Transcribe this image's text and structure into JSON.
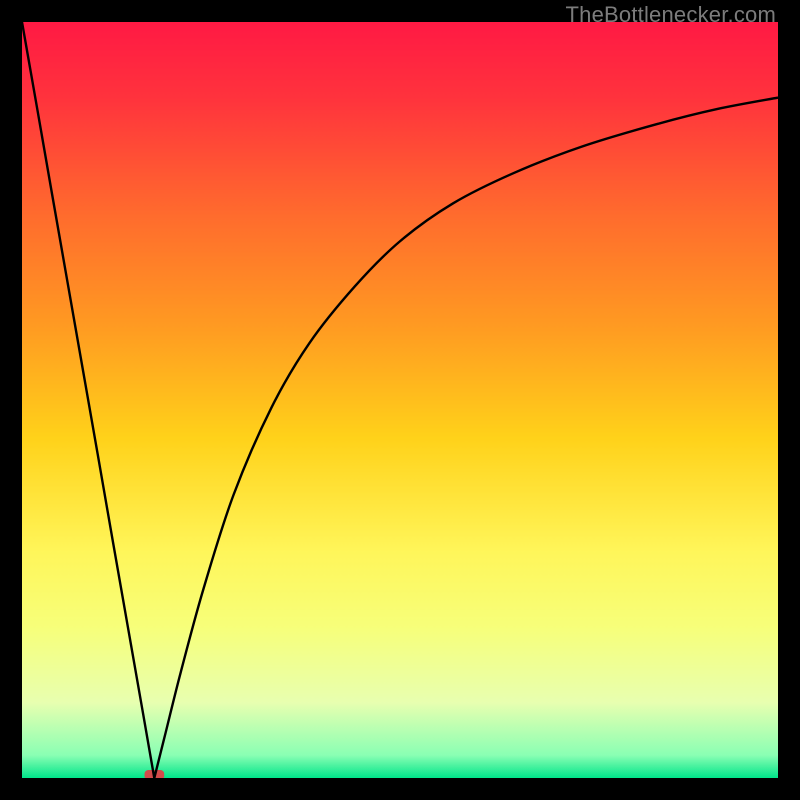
{
  "watermark_text": "TheBottlenecker.com",
  "marker_color": "#d24b4b",
  "curve_color": "#000000",
  "gradient_stops": [
    {
      "offset": 0.0,
      "color": "#ff1a44"
    },
    {
      "offset": 0.1,
      "color": "#ff333d"
    },
    {
      "offset": 0.25,
      "color": "#ff6a2e"
    },
    {
      "offset": 0.4,
      "color": "#ff9a22"
    },
    {
      "offset": 0.55,
      "color": "#ffd21a"
    },
    {
      "offset": 0.7,
      "color": "#fff65a"
    },
    {
      "offset": 0.8,
      "color": "#f7ff7a"
    },
    {
      "offset": 0.9,
      "color": "#e8ffb0"
    },
    {
      "offset": 0.97,
      "color": "#8affb4"
    },
    {
      "offset": 1.0,
      "color": "#00e58a"
    }
  ],
  "chart_data": {
    "type": "line",
    "title": "",
    "xlabel": "",
    "ylabel": "",
    "xlim": [
      0,
      100
    ],
    "ylim": [
      0,
      100
    ],
    "x": [
      0,
      2,
      4,
      6,
      8,
      10,
      12,
      14,
      16,
      17.5,
      19,
      21,
      24,
      28,
      33,
      38,
      44,
      50,
      57,
      65,
      74,
      84,
      92,
      100
    ],
    "values": [
      100,
      88.6,
      77.1,
      65.7,
      54.3,
      42.9,
      31.4,
      20.0,
      8.6,
      0.0,
      6.0,
      14.0,
      25.0,
      37.5,
      49.0,
      57.5,
      65.0,
      71.0,
      76.0,
      80.0,
      83.5,
      86.5,
      88.5,
      90.0
    ],
    "optimal_marker_x": [
      16.2,
      18.8
    ],
    "optimal_marker_y": 0.0,
    "notes": "bottleneck/deviation curve; minimum (optimal) near x≈17.5; background is a vertical red→green gradient indicating deviation severity"
  }
}
